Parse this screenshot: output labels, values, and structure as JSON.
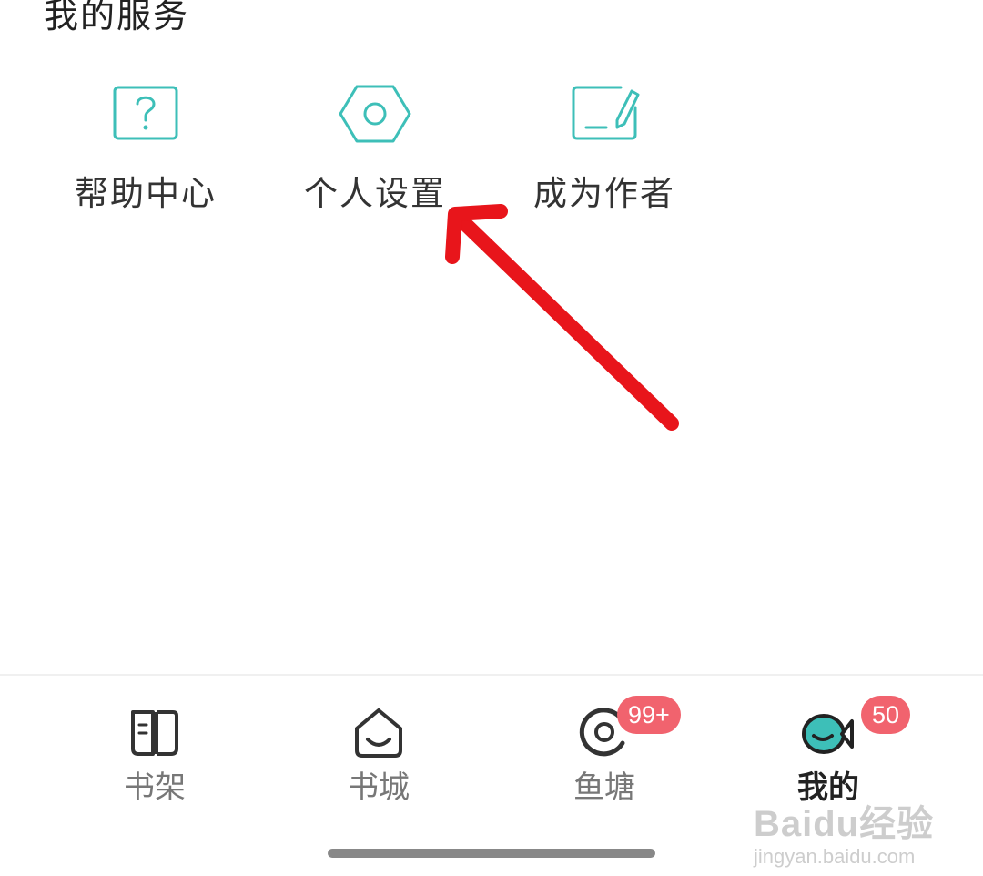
{
  "section": {
    "title": "我的服务"
  },
  "services": [
    {
      "label": "帮助中心",
      "icon": "help-question-icon"
    },
    {
      "label": "个人设置",
      "icon": "settings-hexagon-icon"
    },
    {
      "label": "成为作者",
      "icon": "become-author-edit-icon"
    }
  ],
  "annotation": {
    "arrow_color": "#e8151b",
    "arrow_target": "个人设置"
  },
  "tabs": [
    {
      "label": "书架",
      "icon": "bookshelf-icon",
      "active": false
    },
    {
      "label": "书城",
      "icon": "bookstore-home-icon",
      "active": false
    },
    {
      "label": "鱼塘",
      "icon": "fishpond-icon",
      "active": false,
      "badge": "99+"
    },
    {
      "label": "我的",
      "icon": "profile-fish-icon",
      "active": true,
      "badge": "50"
    }
  ],
  "watermark": {
    "main": "Baidu经验",
    "sub": "jingyan.baidu.com"
  },
  "colors": {
    "accent": "#3dbfb8",
    "badge": "#f1636e",
    "annotation": "#e8151b"
  }
}
